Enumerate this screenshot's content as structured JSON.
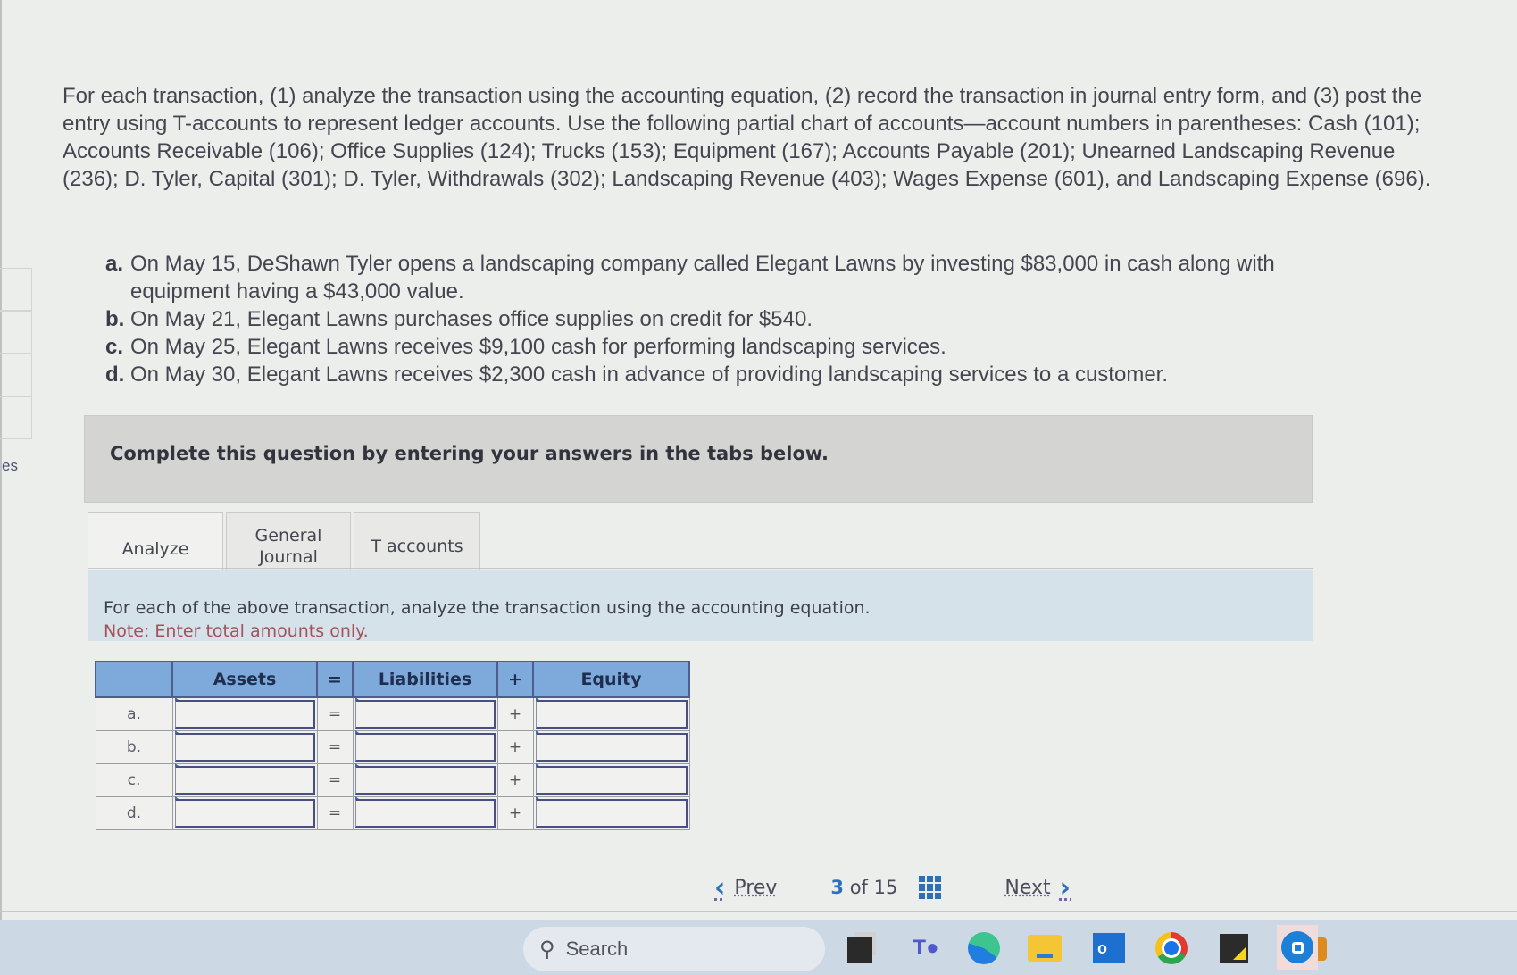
{
  "sidebar_fragment": {
    "label": "es"
  },
  "question": {
    "intro": "For each transaction, (1) analyze the transaction using the accounting equation, (2) record the transaction in journal entry form, and (3) post the entry using T-accounts to represent ledger accounts. Use the following partial chart of accounts—account numbers in parentheses: Cash (101); Accounts Receivable (106); Office Supplies (124); Trucks (153); Equipment (167); Accounts Payable (201); Unearned Landscaping Revenue (236); D. Tyler, Capital (301); D. Tyler, Withdrawals (302); Landscaping Revenue (403); Wages Expense (601), and Landscaping Expense (696).",
    "transactions": [
      {
        "letter": "a.",
        "text": "On May 15, DeShawn Tyler opens a landscaping company called Elegant Lawns by investing $83,000 in cash along with equipment having a $43,000 value."
      },
      {
        "letter": "b.",
        "text": "On May 21, Elegant Lawns purchases office supplies on credit for $540."
      },
      {
        "letter": "c.",
        "text": "On May 25, Elegant Lawns receives $9,100 cash for performing landscaping services."
      },
      {
        "letter": "d.",
        "text": "On May 30, Elegant Lawns receives $2,300 cash in advance of providing landscaping services to a customer."
      }
    ]
  },
  "banner": {
    "text": "Complete this question by entering your answers in the tabs below."
  },
  "tabs": [
    {
      "label": "Analyze",
      "active": true
    },
    {
      "label": "General Journal",
      "active": false
    },
    {
      "label": "T accounts",
      "active": false
    }
  ],
  "instructions": {
    "line1": "For each of the above transaction, analyze the transaction using the accounting equation.",
    "note": "Note: Enter total amounts only."
  },
  "equation_table": {
    "headers": [
      "",
      "Assets",
      "=",
      "Liabilities",
      "+",
      "Equity"
    ],
    "rows": [
      {
        "label": "a.",
        "assets": "",
        "eq": "=",
        "liabilities": "",
        "plus": "+",
        "equity": ""
      },
      {
        "label": "b.",
        "assets": "",
        "eq": "=",
        "liabilities": "",
        "plus": "+",
        "equity": ""
      },
      {
        "label": "c.",
        "assets": "",
        "eq": "=",
        "liabilities": "",
        "plus": "+",
        "equity": ""
      },
      {
        "label": "d.",
        "assets": "",
        "eq": "=",
        "liabilities": "",
        "plus": "+",
        "equity": ""
      }
    ]
  },
  "pager": {
    "prev_label": "Prev",
    "current": "3",
    "of_label": "of",
    "total": "15",
    "next_label": "Next"
  },
  "taskbar": {
    "search_label": "Search",
    "icons": [
      "windows-start-icon",
      "search-icon",
      "briefcase-icon",
      "snipping-tool-icon",
      "teams-icon",
      "edge-icon",
      "file-explorer-icon",
      "outlook-icon",
      "chrome-icon",
      "sticky-notes-icon",
      "blue-app-icon"
    ]
  },
  "colors": {
    "table_header": "#7ea9db",
    "accent_blue": "#2f6fb8",
    "note_red": "#a4515a",
    "instruction_bg": "#d6e2ea",
    "banner_bg": "#d4d5d3"
  }
}
